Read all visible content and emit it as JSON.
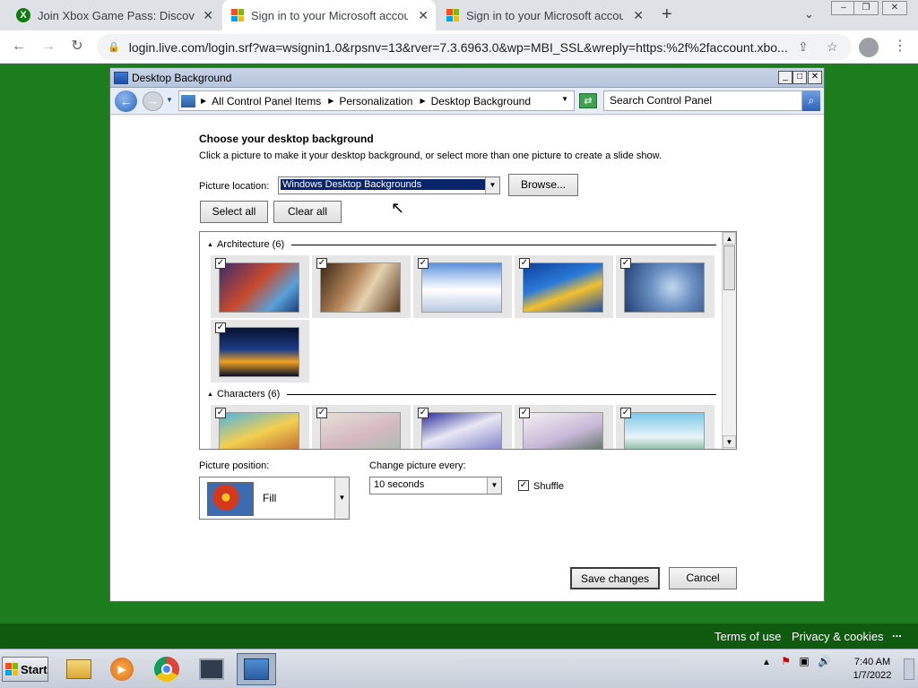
{
  "browser": {
    "tabs": [
      {
        "title": "Join Xbox Game Pass: Discover Y",
        "icon": "xbox-icon"
      },
      {
        "title": "Sign in to your Microsoft accoun",
        "icon": "microsoft-icon"
      },
      {
        "title": "Sign in to your Microsoft accoun",
        "icon": "microsoft-icon"
      }
    ],
    "url": "login.live.com/login.srf?wa=wsignin1.0&rpsnv=13&rver=7.3.6963.0&wp=MBI_SSL&wreply=https:%2f%2faccount.xbo..."
  },
  "page_footer": {
    "terms": "Terms of use",
    "privacy": "Privacy & cookies",
    "more": "..."
  },
  "dialog": {
    "title": "Desktop Background",
    "breadcrumbs": [
      "All Control Panel Items",
      "Personalization",
      "Desktop Background"
    ],
    "search_placeholder": "Search Control Panel",
    "heading": "Choose your desktop background",
    "description": "Click a picture to make it your desktop background, or select more than one picture to create a slide show.",
    "picture_location_label": "Picture location:",
    "picture_location_value": "Windows Desktop Backgrounds",
    "browse_label": "Browse...",
    "select_all_label": "Select all",
    "clear_all_label": "Clear all",
    "groups": [
      {
        "name": "Architecture (6)"
      },
      {
        "name": "Characters (6)"
      }
    ],
    "picture_position_label": "Picture position:",
    "picture_position_value": "Fill",
    "change_every_label": "Change picture every:",
    "change_every_value": "10 seconds",
    "shuffle_label": "Shuffle",
    "shuffle_checked": true,
    "save_label": "Save changes",
    "cancel_label": "Cancel"
  },
  "taskbar": {
    "start_label": "Start",
    "time": "7:40 AM",
    "date": "1/7/2022"
  }
}
